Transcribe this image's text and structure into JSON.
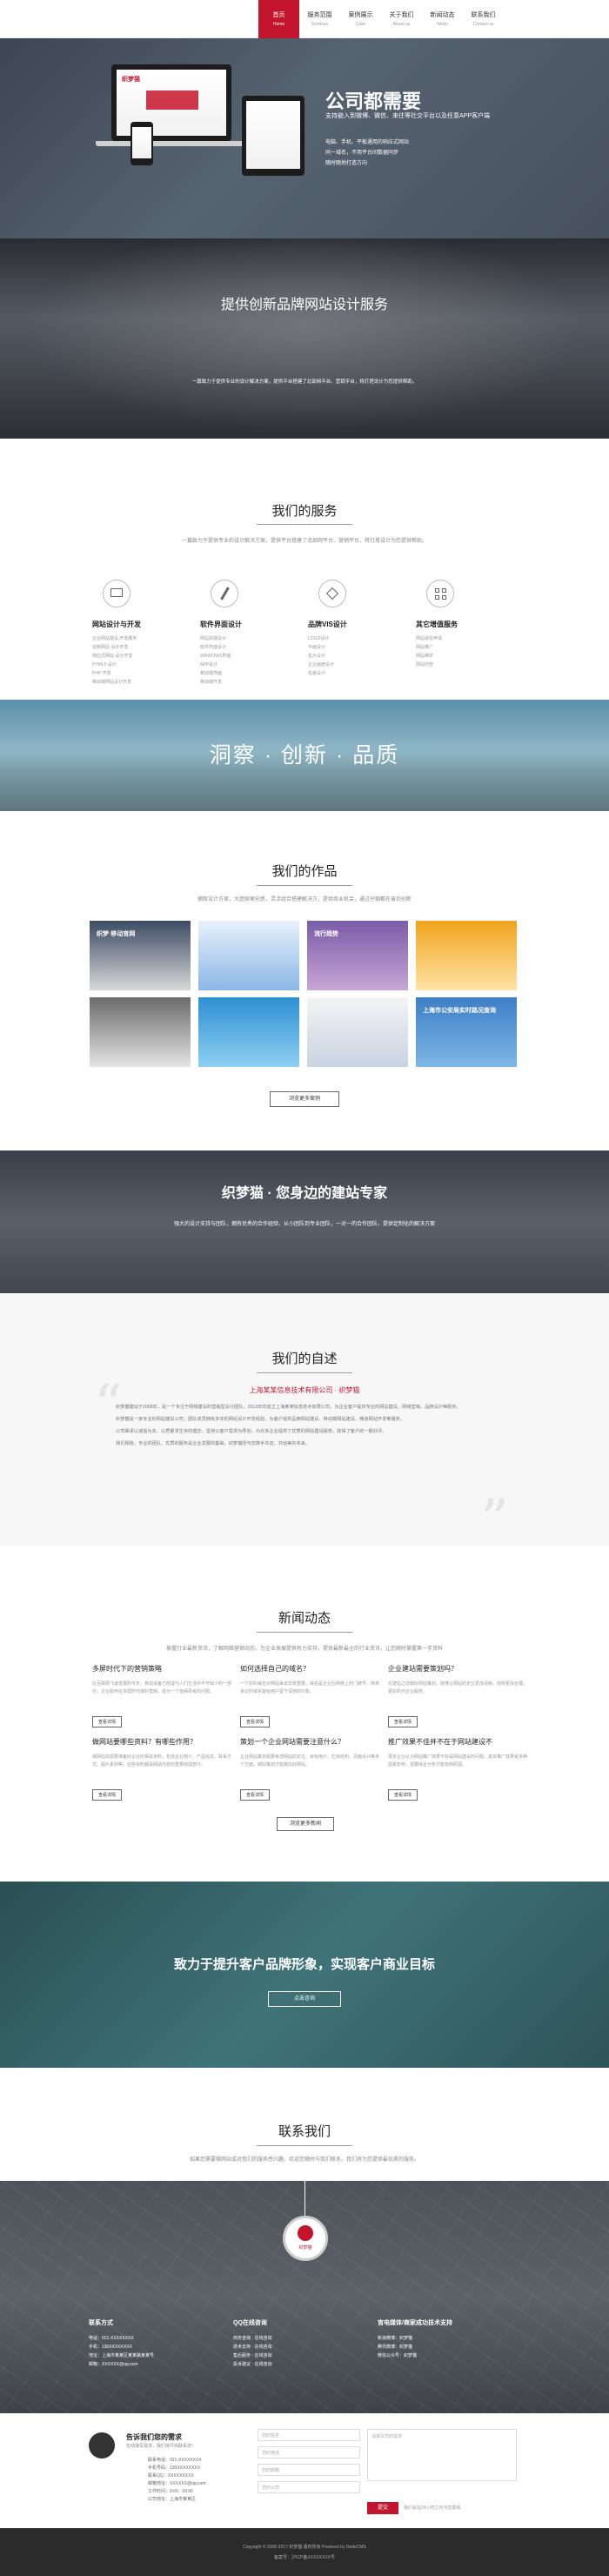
{
  "nav": {
    "items": [
      {
        "zh": "首页",
        "en": "Home"
      },
      {
        "zh": "服务范围",
        "en": "Services"
      },
      {
        "zh": "案例展示",
        "en": "Case"
      },
      {
        "zh": "关于我们",
        "en": "About us"
      },
      {
        "zh": "新闻动态",
        "en": "News"
      },
      {
        "zh": "联系我们",
        "en": "Contact us"
      }
    ]
  },
  "hero": {
    "title": "公司都需要",
    "subtitle": "支持嵌入到微博、微信、来往等社交平台以及任意APP客户端",
    "features": [
      "电脑、手机、平板通用的响应式网站",
      "同一域名，不用平台间数据同步",
      "随时随地打造方向"
    ],
    "screen_brand": "织梦猫"
  },
  "brand_section": {
    "title": "提供创新品牌网站设计服务",
    "desc": "一篇致力于提供专业的设计解决方案，提供平台搭建了北部网平台、营销平台，将灯塔设计为您提供帮助。"
  },
  "services": {
    "title": "我们的服务",
    "desc": "一篇致力于提供专业的设计解决方案，提供平台搭建了北部网平台、营销平台，将灯塔设计为您提供帮助。",
    "items": [
      {
        "title": "网站设计与开发",
        "lines": [
          "企业网站建设 开发服务",
          "定制网站 设计开发",
          "响应式网站 设计开发",
          "HTML5 设计",
          "PHP 开发",
          "移动端网站设计开发"
        ]
      },
      {
        "title": "软件界面设计",
        "lines": [
          "网站前端设计",
          "软件界面设计",
          "WINDOWS界面",
          "APP设计",
          "移动端界面",
          "移动端开发"
        ]
      },
      {
        "title": "品牌VIS设计",
        "lines": [
          "LOGO设计",
          "平面设计",
          "名片设计",
          "企业画册设计",
          "包装设计"
        ]
      },
      {
        "title": "其它增值服务",
        "lines": [
          "网站域名申请",
          "网站推广",
          "网站维护",
          "网站托管"
        ]
      }
    ]
  },
  "banner": {
    "title": "洞察 · 创新 · 品质"
  },
  "works": {
    "title": "我们的作品",
    "desc": "摘取设计方案，大胆探索创意，灵活组合搭建解决方，提供商业机会，通过仔细都在奋劲创新",
    "items": [
      "织梦·移动官网",
      "",
      "流行趋势",
      "",
      "",
      "",
      "",
      "",
      "",
      "上海市公安局实时路况查询"
    ],
    "more": "浏览更多案例"
  },
  "expert": {
    "title": "织梦猫 · 您身边的建站专家",
    "desc": "强大的设计支持与团队，拥有优秀的合作经验，从小团队到专业团队，一对一的合作团队，提供定制化的解决方案"
  },
  "about": {
    "title": "我们的自述",
    "company": "上海某某信息技术有限公司 · 织梦猫",
    "paragraphs": [
      "织梦猫建站于2008年，是一个专注于网络建设的营销型设计团队，2013年时成立上海某某信息技术有限公司，为企业客户提供专业的网站建设、网络营销、品牌设计等服务。",
      "织梦猫是一家专业的网站建设公司，团队成员拥有多年的网站设计开发经验，为客户提供品牌网站建设、移动端网站建设、微信网站开发等服务。",
      "公司秉承以诚信为本、以质量求生存的理念，坚持以客户需求为导向，为众多企业提供了优质的网站建设服务，获得了客户的一致好评。",
      "我们相信，专业的团队、优质的服务是企业发展的基础，织梦猫愿与您携手共进，共创美好未来。"
    ]
  },
  "news": {
    "title": "新闻动态",
    "desc": "掌握行业最新资讯，了解网络营销动态，为企业发展提供有力支持，提供最新最全的行业资讯，让您随时掌握第一手资料",
    "items": [
      {
        "title": "多屏时代下的营销策略",
        "text": "在互联网飞速发展的今天，移动设备已经成为人们生活中不可缺少的一部分，企业如何在多屏时代做好营销，成为一个值得思考的问题。",
        "more": "查看详情"
      },
      {
        "title": "如何选择自己的域名？",
        "text": "一个好的域名对网站来说非常重要，域名是企业在网络上的门牌号，简单易记的域名能给用户留下深刻的印象。",
        "more": "查看详情"
      },
      {
        "title": "企业建站需要策划吗？",
        "text": "在建站之前做好网站策划，能够让网站的定位更加清晰，结构更加合理，更好的为企业服务。",
        "more": "查看详情"
      },
      {
        "title": "做网站要哪些资料？有哪些作用？",
        "text": "做网站前需要准备好企业的相关资料，包括企业简介、产品信息、联系方式、图片素材等，这些资料都是网站内容的重要组成部分。",
        "more": "查看详情"
      },
      {
        "title": "策划一个企业网站需要注意什么？",
        "text": "企业网站策划需要考虑网站的定位、目标用户、栏目结构、页面设计等多个方面，做好策划才能做出好网站。",
        "more": "查看详情"
      },
      {
        "title": "推广效果不佳并不在于网站建设不",
        "text": "很多企业认为网站推广效果不好是网站建设的问题，其实推广效果受多种因素影响，需要综合分析才能找到原因。",
        "more": "查看详情"
      }
    ],
    "more": "浏览更多新闻"
  },
  "promo": {
    "title": "致力于提升客户品牌形象，实现客户商业目标",
    "cta": "点击咨询"
  },
  "contact": {
    "title": "联系我们",
    "desc": "如果您需要做网站或对我们的服务感兴趣，欢迎您随时与我们联系，我们将为您提供最优质的服务。"
  },
  "map": {
    "pin_label": "织梦猫",
    "cols": [
      {
        "title": "联系方式",
        "lines": [
          "电话：021-XXXXXXXX",
          "手机：130XXXXXXXX",
          "地址：上海市某某区某某路某某号",
          "邮箱：XXXXXX@qq.com"
        ]
      },
      {
        "title": "QQ在线咨询",
        "lines": [
          "商务咨询 · 在线咨询",
          "技术支持 · 在线咨询",
          "售后服务 · 在线咨询",
          "投诉建议 · 在线咨询"
        ]
      },
      {
        "title": "官电媒体/商家成功技术支持",
        "lines": [
          "新浪微博：织梦猫",
          "腾讯微博：织梦猫",
          "微信公众号：织梦猫"
        ]
      }
    ]
  },
  "form": {
    "title": "告诉我们您的需求",
    "subtitle": "在线填写需求，我们将尽快联系您！",
    "info": [
      "联系电话：021-XXXXXXXX",
      "手机号码：130XXXXXXXX",
      "联系QQ：XXXXXXXXX",
      "邮箱地址：XXXXXX@qq.com",
      "工作时间：9:00 - 18:00",
      "公司地址：上海市某某区"
    ],
    "fields": [
      "您的姓名",
      "您的电话",
      "您的邮箱",
      "您的公司"
    ],
    "message_placeholder": "请填写您的需求",
    "submit": "提交",
    "note": "我们会在24小时之内与您联系"
  },
  "footer": {
    "line1": "Copyright © 2008-2017 织梦猫 版权所有 Powered by DedeCMS",
    "line2": "备案号：沪ICP备XXXXXXXX号"
  },
  "colors": {
    "accent": "#c4152e",
    "dark": "#2b2b2b"
  }
}
